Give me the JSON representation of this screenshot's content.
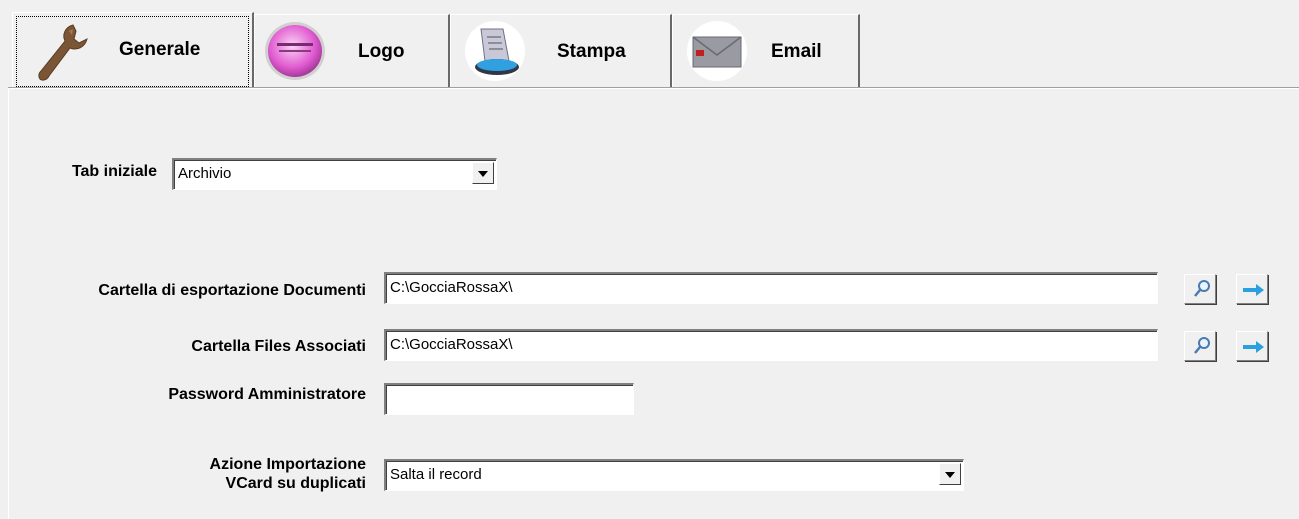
{
  "tabs": [
    {
      "label": "Generale",
      "icon": "wrench-icon"
    },
    {
      "label": "Logo",
      "icon": "logo-disc-icon"
    },
    {
      "label": "Stampa",
      "icon": "printer-icon"
    },
    {
      "label": "Email",
      "icon": "envelope-icon"
    }
  ],
  "form": {
    "tab_iniziale": {
      "label": "Tab iniziale",
      "value": "Archivio"
    },
    "cartella_export": {
      "label": "Cartella di esportazione Documenti",
      "value": "C:\\GocciaRossaX\\"
    },
    "cartella_files": {
      "label": "Cartella Files Associati",
      "value": "C:\\GocciaRossaX\\"
    },
    "password": {
      "label": "Password Amministratore",
      "value": ""
    },
    "azione": {
      "label_line1": "Azione Importazione",
      "label_line2": "VCard su duplicati",
      "value": "Salta il record"
    }
  },
  "colors": {
    "arrow": "#2aa0e0",
    "panel": "#f0f0f0"
  }
}
